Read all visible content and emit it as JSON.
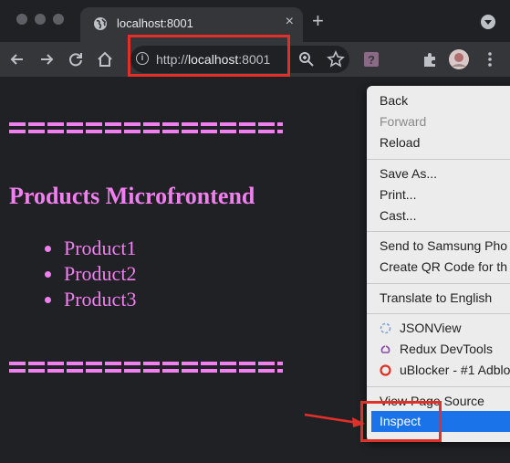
{
  "tab": {
    "title": "localhost:8001",
    "close": "×"
  },
  "new_tab": "+",
  "omnibox": {
    "url_prefix": "http://",
    "url_host": "localhost",
    "url_port": ":8001"
  },
  "page": {
    "title": "Products Microfrontend",
    "products": [
      "Product1",
      "Product2",
      "Product3"
    ],
    "accent_color": "#f07ff0"
  },
  "context_menu": {
    "back": "Back",
    "forward": "Forward",
    "reload": "Reload",
    "save_as": "Save As...",
    "print": "Print...",
    "cast": "Cast...",
    "send_to_samsung": "Send to Samsung Pho",
    "create_qr": "Create QR Code for th",
    "translate": "Translate to English",
    "jsonview": "JSONView",
    "redux": "Redux DevTools",
    "ublocker": "uBlocker - #1 Adblo",
    "view_source": "View Page Source",
    "inspect": "Inspect"
  },
  "colors": {
    "annotation": "#e0302a",
    "selected": "#1a73e8"
  }
}
